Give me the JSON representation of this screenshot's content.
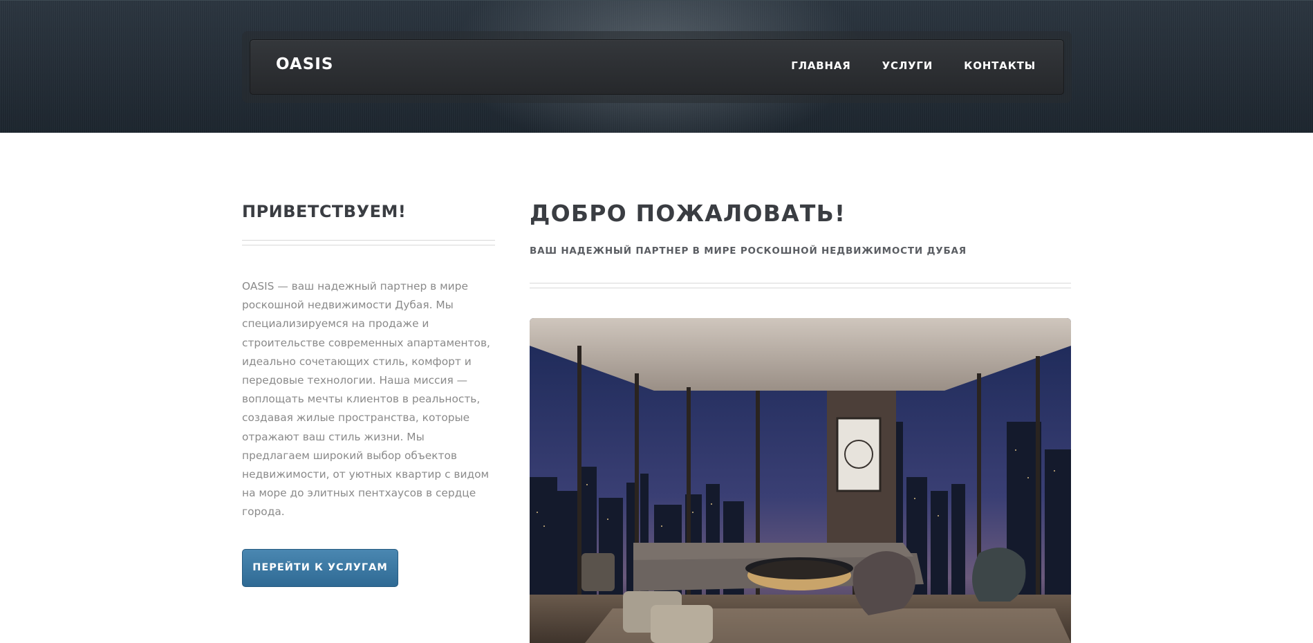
{
  "header": {
    "logo": "OASIS",
    "nav": [
      "ГЛАВНАЯ",
      "УСЛУГИ",
      "КОНТАКТЫ"
    ]
  },
  "sidebar": {
    "title": "ПРИВЕТСТВУЕМ!",
    "body": "OASIS — ваш надежный партнер в мире роскошной недвижимости Дубая. Мы специализируемся на продаже и строительстве современных апартаментов, идеально сочетающих стиль, комфорт и передовые технологии. Наша миссия — воплощать мечты клиентов в реальность, создавая жилые пространства, которые отражают ваш стиль жизни. Мы предлагаем широкий выбор объектов недвижимости, от уютных квартир с видом на море до элитных пентхаусов в сердце города.",
    "button": "ПЕРЕЙТИ К УСЛУГАМ"
  },
  "main": {
    "title": "ДОБРО ПОЖАЛОВАТЬ!",
    "subtitle": "ВАШ НАДЕЖНЫЙ ПАРТНЕР В МИРЕ РОСКОШНОЙ НЕДВИЖИМОСТИ ДУБАЯ"
  },
  "colors": {
    "header_bg": "#1f2830",
    "nav_bg": "#2b2d30",
    "heading": "#3a3d42",
    "body_text": "#8a8a8a",
    "button": "#3a77a1"
  }
}
